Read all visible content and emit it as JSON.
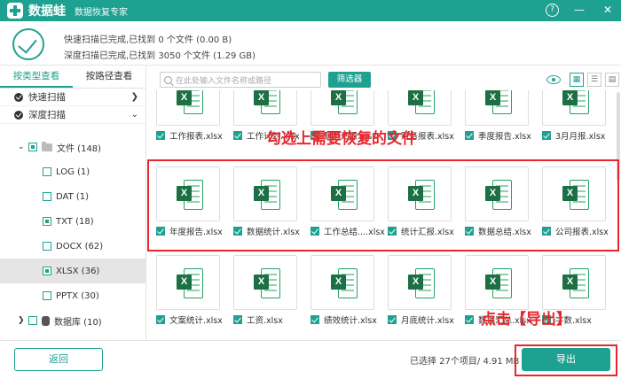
{
  "app": {
    "name": "数据蛙",
    "subtitle": "数据恢复专家"
  },
  "window": {
    "help": "?",
    "minimize": "—",
    "close": "✕"
  },
  "status": {
    "quick": "快速扫描已完成,已找到 0 个文件 (0.00  B)",
    "deep": "深度扫描已完成,已找到 3050 个文件 (1.29 GB)"
  },
  "sidebar": {
    "tabs": [
      "按类型查看",
      "按路径查看"
    ],
    "scans": [
      "快速扫描",
      "深度扫描"
    ],
    "tree": {
      "root": "文件 (148)",
      "items": [
        "LOG (1)",
        "DAT (1)",
        "TXT (18)",
        "DOCX (62)",
        "XLSX (36)",
        "PPTX (30)"
      ],
      "db": "数据库 (10)"
    }
  },
  "toolbar": {
    "search_placeholder": "在此处输入文件名称或路径",
    "filter_label": "筛选器"
  },
  "files": {
    "row1": [
      "工作报表.xlsx",
      "工作计划.xlsx",
      "财务汇报.xlsx",
      "财务报表.xlsx",
      "季度报告.xlsx",
      "3月月报.xlsx"
    ],
    "row2": [
      "年度报告.xlsx",
      "数据统计.xlsx",
      "工作总结....xlsx",
      "统计汇报.xlsx",
      "数据总结.xlsx",
      "公司报表.xlsx"
    ],
    "row3": [
      "文案统计.xlsx",
      "工资.xlsx",
      "绩效统计.xlsx",
      "月底统计.xlsx",
      "数据汇总.xlsx",
      "字数.xlsx"
    ],
    "badge": "X"
  },
  "annotations": {
    "select_note": "勾选上需要恢复的文件",
    "export_note": "点击【导出】"
  },
  "bottom": {
    "back_label": "返回",
    "selection_info": "已选择 27个项目/ 4.91 MB",
    "export_label": "导出"
  },
  "colors": {
    "accent": "#1fa191",
    "annotation": "#e8262c",
    "excel": "#1d7044"
  },
  "icons": [
    "logo-icon",
    "help-icon",
    "minimize-icon",
    "close-icon",
    "scan-complete-check-icon",
    "search-icon",
    "eye-icon",
    "grid-view-icon",
    "list-view-icon",
    "detail-view-icon",
    "folder-icon",
    "database-icon",
    "excel-file-icon"
  ]
}
